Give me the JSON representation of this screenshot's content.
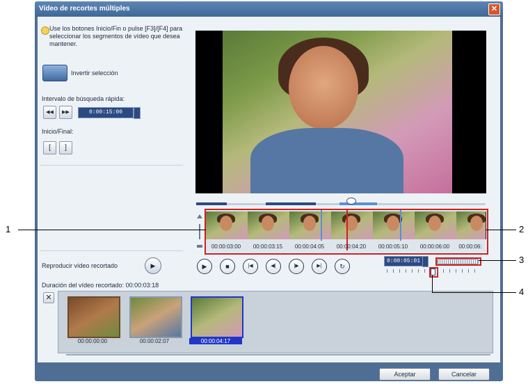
{
  "dialog": {
    "title": "Vídeo de recortes múltiples",
    "close_glyph": "✕"
  },
  "left": {
    "hint": "Use los botones Inicio/Fin o pulse [F3]/[F4] para seleccionar los segmentos de vídeo que desea mantener.",
    "invert_label": "Invertir selección",
    "interval_label": "Intervalo de búsqueda rápida:",
    "rewind_glyph": "◀◀",
    "forward_glyph": "▶▶",
    "interval_value": "0:00:15:00",
    "start_end_label": "Inicio/Final:",
    "start_glyph": "[",
    "end_glyph": "]",
    "play_trimmed_label": "Reproducir vídeo recortado",
    "duration_label": "Duración del vídeo recortado: 00:00:03:18"
  },
  "timeline": {
    "thumb_labels": [
      "00:00:03:00",
      "00:00:03:15",
      "00:00:04:05",
      "00:00:04:20",
      "00:00:05:10",
      "00:00:06:00",
      "00:00:06:"
    ]
  },
  "controls": {
    "play": "▶",
    "stop": "■",
    "home": "|◀",
    "prev": "◀|",
    "next": "|▶",
    "end": "▶|",
    "repeat": "↻",
    "timecode": "0:00:05:01"
  },
  "clips": {
    "labels": [
      "00:00:00:00",
      "00:00:02:07",
      "00:00:04:17"
    ]
  },
  "buttons": {
    "accept": "Aceptar",
    "cancel": "Cancelar"
  },
  "callouts": {
    "n1": "1",
    "n2": "2",
    "n3": "3",
    "n4": "4"
  },
  "colors": {
    "frame": "#4f6e94",
    "highlight_red": "#d02020",
    "timecode_bg": "#2c4a82"
  }
}
